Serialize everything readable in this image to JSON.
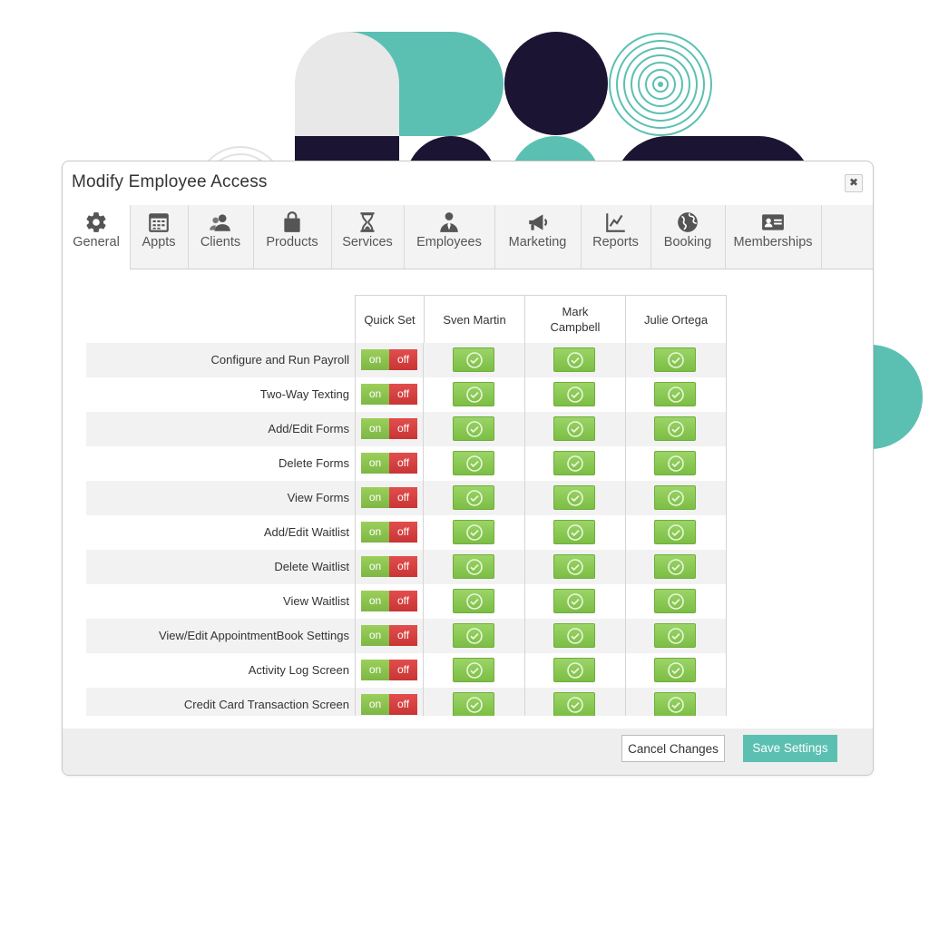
{
  "dialog": {
    "title": "Modify Employee Access",
    "close_label": "✖"
  },
  "tabs": [
    {
      "label": "General",
      "icon": "gear-icon"
    },
    {
      "label": "Appts",
      "icon": "calendar-icon"
    },
    {
      "label": "Clients",
      "icon": "clients-icon"
    },
    {
      "label": "Products",
      "icon": "shopping-bag-icon"
    },
    {
      "label": "Services",
      "icon": "hourglass-icon"
    },
    {
      "label": "Employees",
      "icon": "employee-icon"
    },
    {
      "label": "Marketing",
      "icon": "megaphone-icon"
    },
    {
      "label": "Reports",
      "icon": "line-chart-icon"
    },
    {
      "label": "Booking",
      "icon": "globe-icon"
    },
    {
      "label": "Memberships",
      "icon": "id-card-icon"
    }
  ],
  "grid": {
    "quick_set_header": "Quick Set",
    "on_label": "on",
    "off_label": "off",
    "employees": [
      "Sven Martin",
      "Mark Campbell",
      "Julie Ortega"
    ],
    "permissions": [
      "Configure and Run Payroll",
      "Two-Way Texting",
      "Add/Edit Forms",
      "Delete Forms",
      "View Forms",
      "Add/Edit Waitlist",
      "Delete Waitlist",
      "View Waitlist",
      "View/Edit AppointmentBook Settings",
      "Activity Log Screen",
      "Credit Card Transaction Screen"
    ],
    "all_enabled": true
  },
  "footer": {
    "cancel_label": "Cancel Changes",
    "save_label": "Save Settings"
  },
  "colors": {
    "accent": "#5bc0b2",
    "navy": "#1c1433",
    "on_green": "#8bc34a",
    "off_red": "#d63c3c"
  }
}
